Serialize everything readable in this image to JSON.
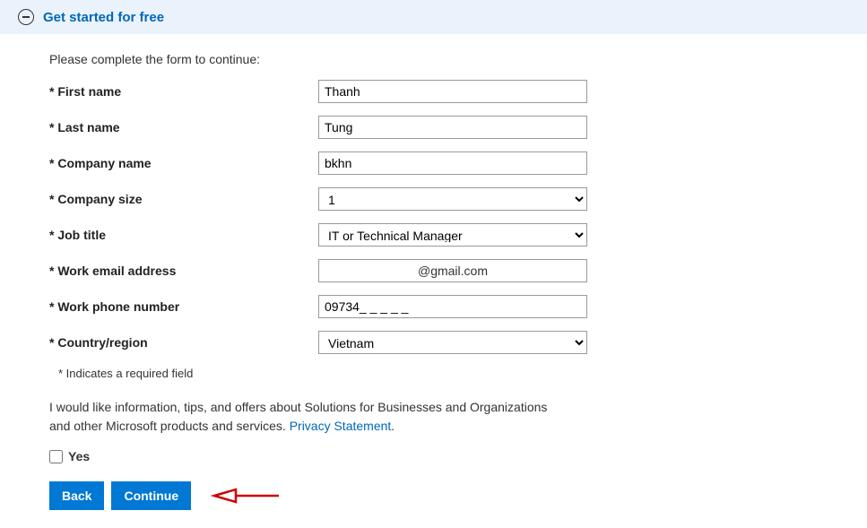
{
  "header": {
    "title": "Get started for free"
  },
  "form": {
    "intro": "Please complete the form to continue:",
    "fields": {
      "first_name": {
        "label": "* First name",
        "value": "Thanh"
      },
      "last_name": {
        "label": "* Last name",
        "value": "Tung"
      },
      "company_name": {
        "label": "* Company name",
        "value": "bkhn"
      },
      "company_size": {
        "label": "* Company size",
        "value": "1"
      },
      "job_title": {
        "label": "* Job title",
        "value": "IT or Technical Manager"
      },
      "work_email": {
        "label": "* Work email address",
        "value": "@gmail.com"
      },
      "work_phone": {
        "label": "* Work phone number",
        "value": "09734_ _ _ _ _"
      },
      "country": {
        "label": "* Country/region",
        "value": "Vietnam"
      }
    },
    "required_note": "* Indicates a required field",
    "consent_text": "I would like information, tips, and offers about Solutions for Businesses and Organizations and other Microsoft products and services. ",
    "privacy_link": "Privacy Statement",
    "checkbox_label": "Yes",
    "buttons": {
      "back": "Back",
      "continue": "Continue"
    }
  }
}
